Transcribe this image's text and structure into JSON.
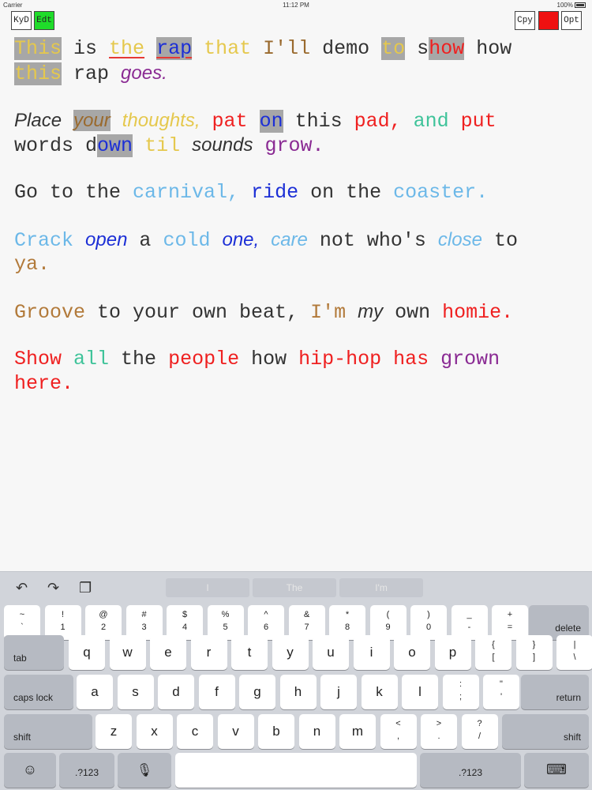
{
  "status": {
    "carrier": "Carrier",
    "time": "11:12 PM",
    "battery": "100%"
  },
  "toolbar": {
    "kyd": "KyD",
    "edt": "Edt",
    "cpy": "Cpy",
    "red": "",
    "opt": "Opt"
  },
  "lines": [
    [
      {
        "t": "This",
        "c": "yellow",
        "hl": true
      },
      {
        "t": " is "
      },
      {
        "t": "the",
        "c": "yellow",
        "ul": true
      },
      {
        "t": " "
      },
      {
        "t": "rap",
        "c": "blue",
        "hl": true,
        "ul": true
      },
      {
        "t": " "
      },
      {
        "t": "that",
        "c": "yellow"
      },
      {
        "t": " "
      },
      {
        "t": "I'll",
        "c": "brown"
      },
      {
        "t": " demo "
      },
      {
        "t": "to",
        "c": "yellow",
        "hl": true
      },
      {
        "t": " s"
      },
      {
        "t": "how",
        "c": "red",
        "hl": true
      },
      {
        "t": " how"
      }
    ],
    [
      {
        "t": "this",
        "c": "yellow",
        "hl": true
      },
      {
        "t": " rap "
      },
      {
        "t": "goes.",
        "c": "purple",
        "it": true
      }
    ],
    "gap",
    [
      {
        "t": "Place",
        "it": true
      },
      {
        "t": " "
      },
      {
        "t": "your",
        "c": "brown",
        "it": true,
        "hl": true
      },
      {
        "t": " "
      },
      {
        "t": "thoughts,",
        "c": "yellow",
        "it": true
      },
      {
        "t": " "
      },
      {
        "t": "pat",
        "c": "red"
      },
      {
        "t": " "
      },
      {
        "t": "on",
        "c": "blue",
        "hl": true
      },
      {
        "t": " this "
      },
      {
        "t": "pad,",
        "c": "red"
      },
      {
        "t": " "
      },
      {
        "t": "and",
        "c": "teal"
      },
      {
        "t": " "
      },
      {
        "t": "put",
        "c": "red"
      }
    ],
    [
      {
        "t": "words d"
      },
      {
        "t": "own",
        "c": "blue",
        "hl": true
      },
      {
        "t": " "
      },
      {
        "t": "til",
        "c": "yellow"
      },
      {
        "t": " "
      },
      {
        "t": "sounds",
        "it": true
      },
      {
        "t": " "
      },
      {
        "t": "grow.",
        "c": "purple"
      }
    ],
    "gap",
    [
      {
        "t": "Go to the "
      },
      {
        "t": "carnival,",
        "c": "sky"
      },
      {
        "t": " "
      },
      {
        "t": "ride",
        "c": "blue"
      },
      {
        "t": " on the "
      },
      {
        "t": "coaster.",
        "c": "sky"
      }
    ],
    "gap",
    [
      {
        "t": "Crack",
        "c": "sky"
      },
      {
        "t": " "
      },
      {
        "t": "open",
        "c": "blue",
        "it": true
      },
      {
        "t": " a "
      },
      {
        "t": "cold",
        "c": "sky"
      },
      {
        "t": " "
      },
      {
        "t": "one,",
        "c": "blue",
        "it": true
      },
      {
        "t": " "
      },
      {
        "t": "care",
        "c": "sky",
        "it": true
      },
      {
        "t": " not who's "
      },
      {
        "t": "close",
        "c": "sky",
        "it": true
      },
      {
        "t": " to"
      }
    ],
    [
      {
        "t": "ya.",
        "c": "tan"
      }
    ],
    "gap",
    [
      {
        "t": "Groove",
        "c": "tan"
      },
      {
        "t": " to your own beat, "
      },
      {
        "t": "I'm",
        "c": "tan"
      },
      {
        "t": " "
      },
      {
        "t": "my",
        "it": true
      },
      {
        "t": " own "
      },
      {
        "t": "homie.",
        "c": "red"
      }
    ],
    "gap",
    [
      {
        "t": "Show",
        "c": "red"
      },
      {
        "t": " "
      },
      {
        "t": "all",
        "c": "teal"
      },
      {
        "t": " the "
      },
      {
        "t": "people",
        "c": "red"
      },
      {
        "t": " how "
      },
      {
        "t": "hip-hop",
        "c": "red"
      },
      {
        "t": " "
      },
      {
        "t": "has",
        "c": "red"
      },
      {
        "t": " "
      },
      {
        "t": "grown",
        "c": "purple"
      }
    ],
    [
      {
        "t": "here.",
        "c": "red"
      }
    ]
  ],
  "keyboard": {
    "predictions": [
      "I",
      "The",
      "I'm"
    ],
    "tools": {
      "undo": "↶",
      "redo": "↷",
      "paste": "❐"
    },
    "row1": [
      [
        "~",
        "`"
      ],
      [
        "!",
        "1"
      ],
      [
        "@",
        "2"
      ],
      [
        "#",
        "3"
      ],
      [
        "$",
        "4"
      ],
      [
        "%",
        "5"
      ],
      [
        "^",
        "6"
      ],
      [
        "&",
        "7"
      ],
      [
        "*",
        "8"
      ],
      [
        "(",
        "9"
      ],
      [
        ")",
        "0"
      ],
      [
        "_",
        "-"
      ],
      [
        "+",
        "="
      ]
    ],
    "delete": "delete",
    "tab": "tab",
    "row2": [
      "q",
      "w",
      "e",
      "r",
      "t",
      "y",
      "u",
      "i",
      "o",
      "p"
    ],
    "row2_extra": [
      [
        "{",
        "["
      ],
      [
        "}",
        "]"
      ],
      [
        "|",
        "\\"
      ]
    ],
    "caps": "caps lock",
    "row3": [
      "a",
      "s",
      "d",
      "f",
      "g",
      "h",
      "j",
      "k",
      "l"
    ],
    "row3_extra": [
      [
        ":",
        ";"
      ],
      [
        "\"",
        "'"
      ]
    ],
    "return": "return",
    "shift": "shift",
    "row4": [
      "z",
      "x",
      "c",
      "v",
      "b",
      "n",
      "m"
    ],
    "row4_extra": [
      [
        "<",
        ","
      ],
      [
        ">",
        "."
      ],
      [
        "?",
        "/"
      ]
    ],
    "emoji": "☺",
    "num": ".?123",
    "mic": "🎙",
    "kbd": "⌨"
  }
}
